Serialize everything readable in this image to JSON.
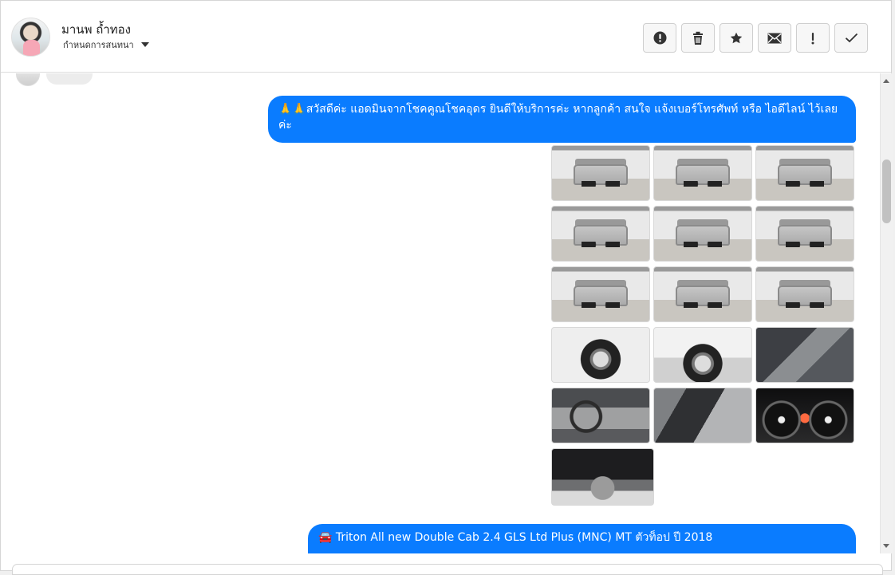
{
  "header": {
    "contact_name": "มานพ ถ้ำทอง",
    "conversation_setting_label": "กำหนดการสนทนา"
  },
  "toolbar": {
    "buttons": [
      "alert-circle-icon",
      "trash-icon",
      "star-icon",
      "mail-icon",
      "exclamation-icon",
      "check-icon"
    ]
  },
  "chat": {
    "messages": [
      {
        "direction": "outgoing",
        "text": "🙏🙏สวัสดีค่ะ แอดมินจากโชคคูณโชคอุดร ยินดีให้บริการค่ะ หากลูกค้า สนใจ แจ้งเบอร์โทรศัพท์ หรือ ไอดีไลน์ ไว้เลยค่ะ"
      },
      {
        "direction": "outgoing",
        "text": "🚘 Triton All new Double Cab 2.4 GLS Ltd Plus (MNC) MT ตัวท็อป ปี 2018"
      }
    ],
    "photo_count": 16
  },
  "colors": {
    "outgoing_bubble": "#0a7cff",
    "header_border": "#dcdcdc",
    "toolbar_button_bg": "#f7f7f7"
  }
}
